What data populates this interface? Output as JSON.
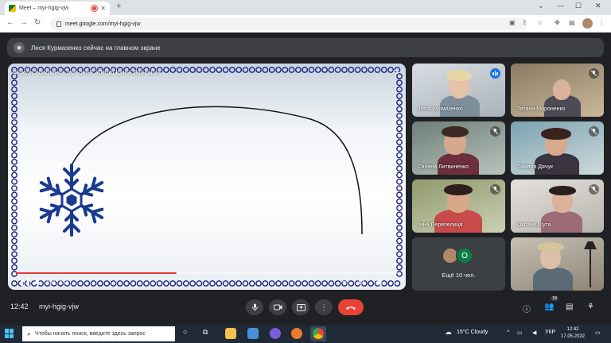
{
  "browser": {
    "tab_title": "Meet – myi-hgig-vjw",
    "tab_close": "✕",
    "new_tab": "+",
    "url": "meet.google.com/myi-hgig-vjw",
    "window_controls": [
      "⌄",
      "—",
      "☐",
      "✕"
    ]
  },
  "banner": {
    "text": "Леся Курмазенко сейчас на главном экране"
  },
  "presentation": {
    "title": "Фізкультхвилинка для очей. Автор Ірина Вінніцька",
    "time": "0:36 / 0:52",
    "progress": 0.42
  },
  "participants": [
    {
      "name": "Леся Курмазенко",
      "mic": "speaking"
    },
    {
      "name": "Тетяна Мороненко",
      "mic": "muted"
    },
    {
      "name": "Галина Литвиненко",
      "mic": "muted"
    },
    {
      "name": "Тамара Дячук",
      "mic": "muted"
    },
    {
      "name": "Інна Перепелиця",
      "mic": "muted"
    },
    {
      "name": "Оксана Шута",
      "mic": "muted"
    }
  ],
  "more_tile": {
    "label": "Ещё 10 чел.",
    "avatar_letter": "О",
    "avatar_color": "#0b8043"
  },
  "bottom_bar": {
    "time": "12:42",
    "meeting_code": "myi-hgig-vjw",
    "participant_count": "18"
  },
  "taskbar": {
    "search_placeholder": "Чтобы начать поиск, введите здесь запрос",
    "weather": "15°C  Cloudy",
    "language": "УКР",
    "time": "12:42",
    "date": "17.05.2022"
  },
  "colors": {
    "meet_background": "#202124",
    "end_call": "#ea4335",
    "speaking": "#1a73e8",
    "snowflake": "#1a3a8f"
  }
}
